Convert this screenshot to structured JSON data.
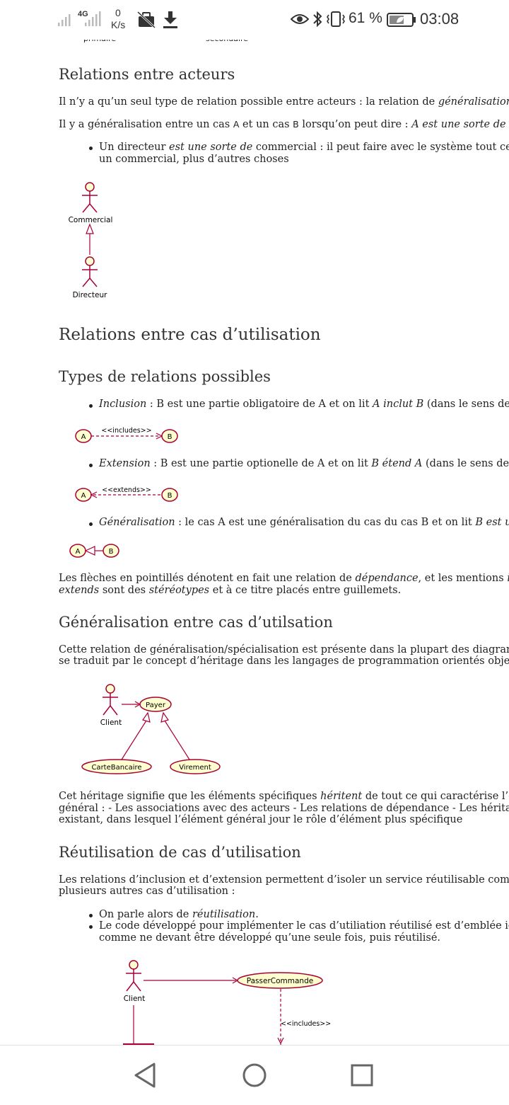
{
  "status": {
    "network": "4G",
    "speed_value": "0",
    "speed_unit": "K/s",
    "battery": "61 %",
    "time": "03:08"
  },
  "top_captions": [
    "primaire",
    "secondaire"
  ],
  "sections": {
    "relations_acteurs": {
      "title": "Relations entre acteurs",
      "p1_a": "Il n’y a qu’un seul type de relation possible entre acteurs : la relation de ",
      "p1_b": "généralisation",
      "p1_c": ".",
      "p2_a": "Il y a généralisation entre un cas ",
      "p2_b": "A",
      "p2_c": " et un cas ",
      "p2_d": "B",
      "p2_e": " lorsqu’on peut dire : ",
      "p2_f": "A est une sorte de B",
      "p2_g": ". E",
      "li1_a": "Un directeur ",
      "li1_b": "est une sorte de",
      "li1_c": " commercial : il peut faire avec le système tout ce q",
      "li1_d": "un commercial, plus d’autres choses",
      "actor_top": "Commercial",
      "actor_bottom": "Directeur"
    },
    "relations_cas": {
      "title": "Relations entre cas d’utilisation"
    },
    "types": {
      "title": "Types de relations possibles",
      "inclusion_a": "Inclusion",
      "inclusion_b": " : B est une partie obligatoire de A et on lit ",
      "inclusion_c": "A inclut B",
      "inclusion_d": " (dans le sens de la",
      "includes_label": "<<includes>>",
      "extension_a": "Extension",
      "extension_b": " : B est une partie optionelle de A et on lit ",
      "extension_c": "B étend A",
      "extension_d": " (dans le sens de la",
      "extends_label": "<<extends>>",
      "generalisation_a": "Généralisation",
      "generalisation_b": " : le cas A est une généralisation du cas du cas B et on lit ",
      "generalisation_c": "B est une",
      "case_a": "A",
      "case_b": "B",
      "note_a": "Les flèches en pointillés dénotent en fait une relation de ",
      "note_b": "dépendance",
      "note_c": ", et les mentions ",
      "note_d": "in",
      "note_e": "extends",
      "note_f": " sont des ",
      "note_g": "stéréotypes",
      "note_h": " et à ce titre placés entre guillemets."
    },
    "generalisation_cas": {
      "title": "Généralisation entre cas d’utilsation",
      "p1": "Cette relation de généralisation/spécialisation est présente dans la plupart des diagram",
      "p2": "se traduit par le concept d’héritage dans les langages de programmation orientés objet",
      "actor": "Client",
      "case_payer": "Payer",
      "case_carte": "CarteBancaire",
      "case_virement": "Virement",
      "p3_a": "Cet héritage signifie que les éléments spécifiques ",
      "p3_b": "héritent",
      "p3_c": " de tout ce qui caractérise l’élé",
      "p4": "général : - Les associations avec des acteurs - Les relations de dépendance - Les héritage",
      "p5": "existant, dans lesquel l’élément général jour le rôle d’élément plus spécifique"
    },
    "reutilisation": {
      "title": "Réutilisation de cas d’utilisation",
      "p1": "Les relations d’inclusion et d’extension permettent d’isoler un service réutilisable com",
      "p2": "plusieurs autres cas d’utilisation :",
      "li1_a": "On parle alors de ",
      "li1_b": "réutilisation",
      "li1_c": ".",
      "li2_a": "Le code développé pour implémenter le cas d’utiliation réutilisé est d’emblée id",
      "li2_b": "comme ne devant être développé qu’une seule fois, puis réutilisé.",
      "actor": "Client",
      "case_passer": "PasserCommande",
      "includes_label": "<<includes>>"
    }
  },
  "colors": {
    "uml_border": "#a80036",
    "uml_fill": "#fefece",
    "text": "#222222",
    "heading": "#333333"
  },
  "navbar": {
    "icons": [
      "back-triangle-icon",
      "home-circle-icon",
      "recents-square-icon"
    ]
  }
}
